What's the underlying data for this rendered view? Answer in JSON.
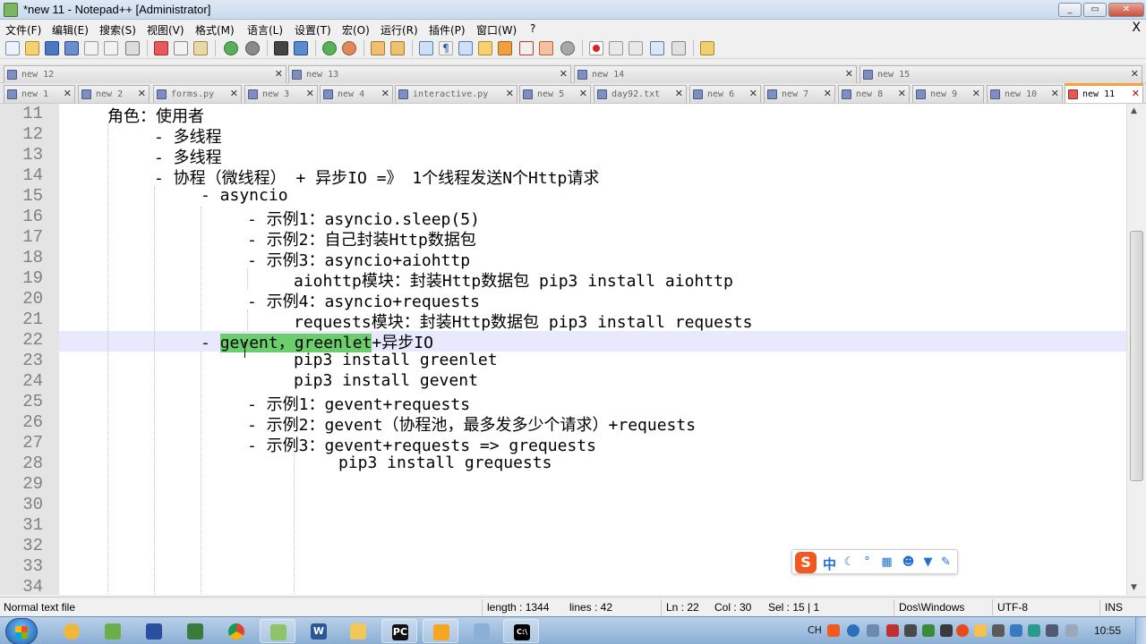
{
  "window": {
    "title": "*new 11 - Notepad++ [Administrator]"
  },
  "menu": {
    "items": [
      "文件(F)",
      "编辑(E)",
      "搜索(S)",
      "视图(V)",
      "格式(M)",
      "语言(L)",
      "设置(T)",
      "宏(O)",
      "运行(R)",
      "插件(P)",
      "窗口(W)",
      "?"
    ],
    "close_label": "X"
  },
  "tabs": {
    "row1": [
      "new 12",
      "new 13",
      "new 14",
      "new 15"
    ],
    "row2": [
      "new 1",
      "new 2",
      "forms.py",
      "new 3",
      "new 4",
      "interactive.py",
      "new 5",
      "day92.txt",
      "new 6",
      "new 7",
      "new 8",
      "new 9",
      "new 10",
      "new 11"
    ],
    "active": "new 11",
    "close_glyph": "✕"
  },
  "editor": {
    "line_numbers": [
      "11",
      "12",
      "13",
      "14",
      "15",
      "16",
      "17",
      "18",
      "19",
      "20",
      "21",
      "22",
      "23",
      "24",
      "25",
      "26",
      "27",
      "28",
      "29",
      "30",
      "31",
      "32",
      "33",
      "34"
    ],
    "lines": [
      "角色：使用者",
      "- 多线程",
      "- 多线程",
      "- 协程（微线程） + 异步IO =》 1个线程发送N个Http请求",
      "- asyncio",
      "- 示例1：asyncio.sleep(5)",
      "- 示例2：自己封装Http数据包",
      "- 示例3：asyncio+aiohttp",
      "aiohttp模块：封装Http数据包 pip3 install aiohttp",
      "- 示例4：asyncio+requests",
      "requests模块：封装Http数据包 pip3 install requests",
      "",
      "pip3 install greenlet",
      "pip3 install gevent",
      "- 示例1：gevent+requests",
      "- 示例2：gevent（协程池，最多发多少个请求）+requests",
      "- 示例3：gevent+requests => grequests",
      "pip3 install grequests",
      "",
      "",
      "",
      "",
      "",
      ""
    ],
    "current_line": {
      "prefix": "- ",
      "selected": "gevent，greenlet",
      "suffix": "+异步IO"
    },
    "selection_color": "#6ccd6c",
    "current_line_color": "#e8e8ff"
  },
  "ime": {
    "logo": "S",
    "mode": "中",
    "icons": [
      "moon-icon",
      "punctuation-icon",
      "keyboard-icon",
      "user-icon",
      "shirt-icon",
      "wrench-icon"
    ]
  },
  "status": {
    "file_type": "Normal text file",
    "length": "length : 1344",
    "lines": "lines : 42",
    "ln": "Ln : 22",
    "col": "Col : 30",
    "sel": "Sel : 15 | 1",
    "eol": "Dos\\Windows",
    "encoding": "UTF-8",
    "mode": "INS"
  },
  "taskbar": {
    "lang": "CH",
    "clock": "10:55"
  }
}
